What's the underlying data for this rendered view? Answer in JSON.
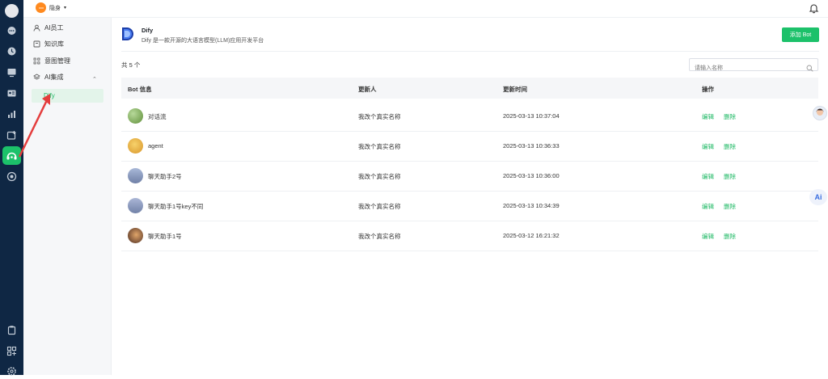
{
  "topbar": {
    "status_label": "隐身",
    "caret": "▾"
  },
  "sidebar": {
    "items": [
      {
        "label": "AI员工",
        "icon": "person-icon"
      },
      {
        "label": "知识库",
        "icon": "book-icon"
      },
      {
        "label": "意图管理",
        "icon": "intent-icon"
      },
      {
        "label": "AI集成",
        "icon": "layers-icon"
      }
    ],
    "collapse": "⌃",
    "sub_item": "Dify"
  },
  "header": {
    "title": "Dify",
    "description": "Dify 是一款开源的大语言模型(LLM)应用开发平台",
    "add_button": "添加 Bot"
  },
  "list": {
    "total": "共 5 个",
    "search_placeholder": "请输入名称",
    "columns": [
      "Bot 信息",
      "更新人",
      "更新时间",
      "操作"
    ],
    "rows": [
      {
        "name": "对话流",
        "updater": "我改个真实名称",
        "time": "2025-03-13 10:37:04",
        "edit": "编辑",
        "delete": "删除"
      },
      {
        "name": "agent",
        "updater": "我改个真实名称",
        "time": "2025-03-13 10:36:33",
        "edit": "编辑",
        "delete": "删除"
      },
      {
        "name": "聊天助手2号",
        "updater": "我改个真实名称",
        "time": "2025-03-13 10:36:00",
        "edit": "编辑",
        "delete": "删除"
      },
      {
        "name": "聊天助手1号key不同",
        "updater": "我改个真实名称",
        "time": "2025-03-13 10:34:39",
        "edit": "编辑",
        "delete": "删除"
      },
      {
        "name": "聊天助手1号",
        "updater": "我改个真实名称",
        "time": "2025-03-12 16:21:32",
        "edit": "编辑",
        "delete": "删除"
      }
    ]
  },
  "floating": {
    "ai_label": "Ai"
  },
  "colors": {
    "rail": "#0f2744",
    "accent": "#1cc16a",
    "status": "#ff8a1f"
  }
}
